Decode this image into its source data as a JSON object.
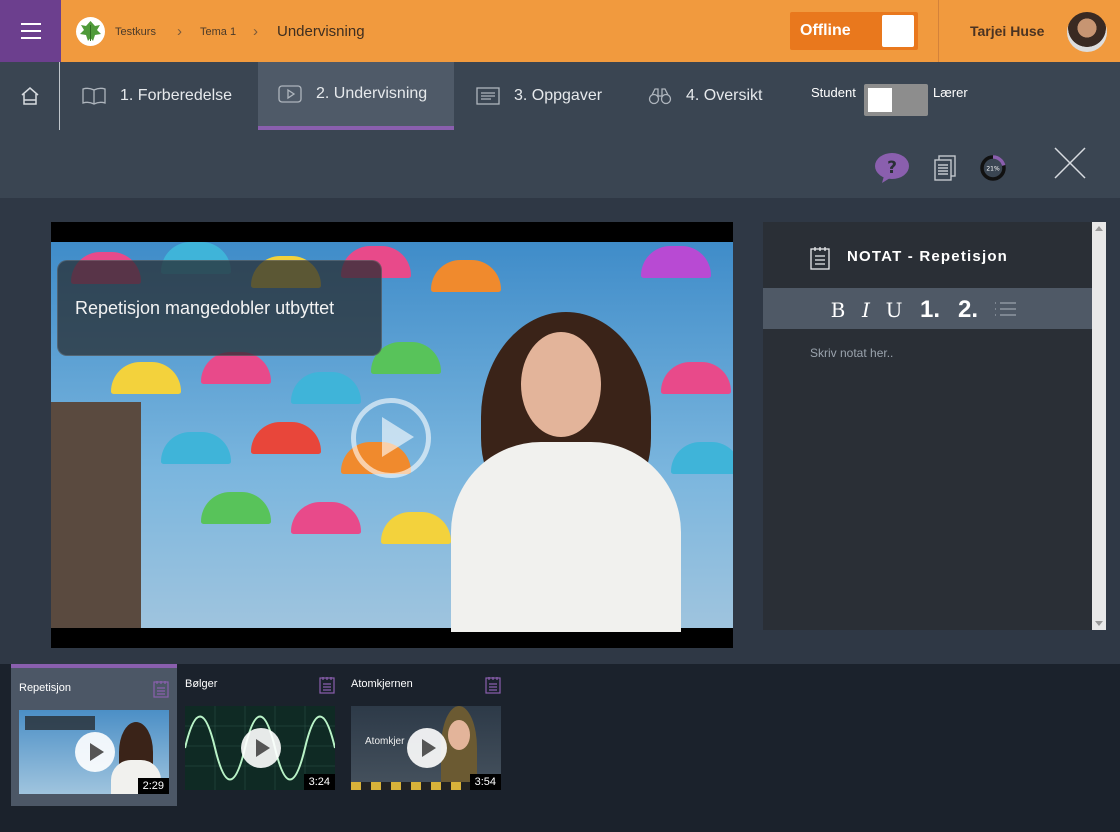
{
  "header": {
    "breadcrumbs": [
      "Testkurs",
      "Tema 1",
      "Undervisning"
    ],
    "offline_label": "Offline",
    "user_name": "Tarjei Huse"
  },
  "nav": {
    "tabs": [
      {
        "label": "1. Forberedelse",
        "icon": "book-icon"
      },
      {
        "label": "2. Undervisning",
        "icon": "video-play-icon",
        "active": true
      },
      {
        "label": "3. Oppgaver",
        "icon": "document-list-icon"
      },
      {
        "label": "4. Oversikt",
        "icon": "binoculars-icon"
      }
    ],
    "mode_left": "Student",
    "mode_right": "Lærer",
    "progress_label": "21%",
    "progress": 0.21
  },
  "video": {
    "caption": "Repetisjon mangedobler utbyttet"
  },
  "note": {
    "title": "NOTAT - Repetisjon",
    "toolbar": {
      "bold": "B",
      "italic": "I",
      "underline": "U",
      "h1": "1.",
      "h2": "2."
    },
    "placeholder": "Skriv notat her.."
  },
  "playlist": [
    {
      "title": "Repetisjon",
      "duration": "2:29",
      "active": true
    },
    {
      "title": "Bølger",
      "duration": "3:24"
    },
    {
      "title": "Atomkjernen",
      "duration": "3:54",
      "thumb_text": "Atomkjer"
    }
  ],
  "colors": {
    "accent": "#f19a3e",
    "purple": "#6c3f8e",
    "nav_bg": "#3a4552"
  }
}
